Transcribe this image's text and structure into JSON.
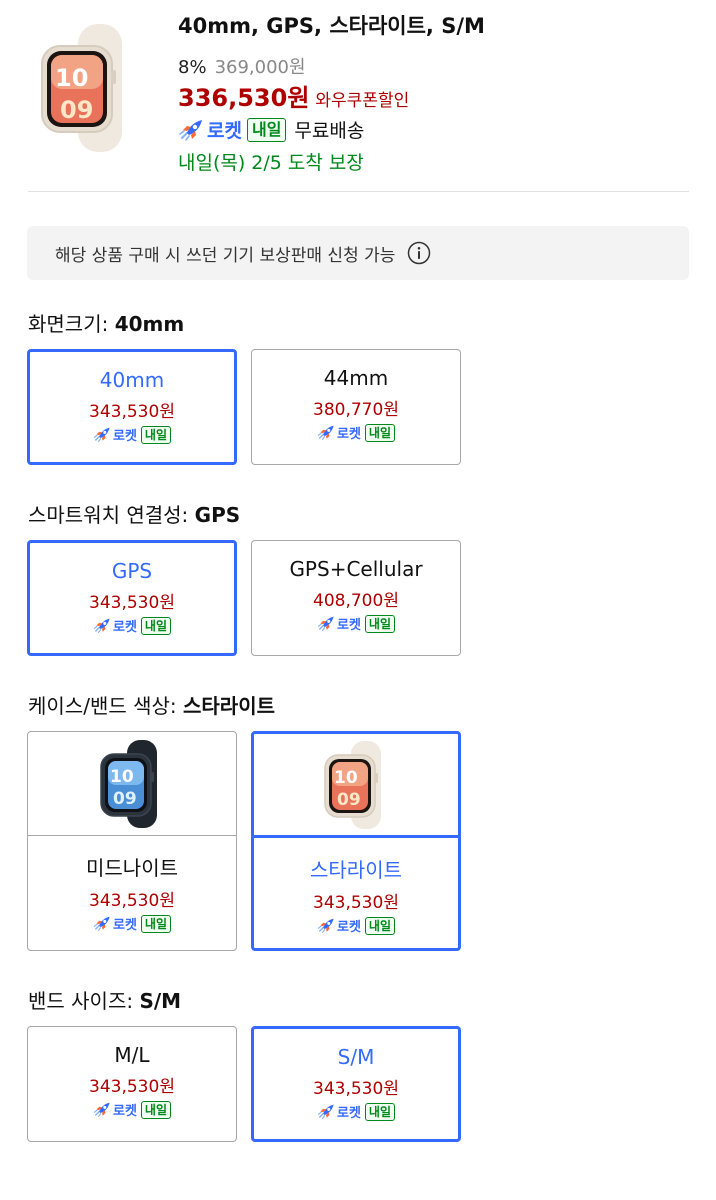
{
  "product": {
    "title": "40mm, GPS, 스타라이트, S/M",
    "discount": "8%",
    "original_price": "369,000원",
    "sale_price": "336,530원",
    "coupon_label": "와우쿠폰할인",
    "rocket_label": "로켓",
    "rocket_badge": "내일",
    "shipping": "무료배송",
    "delivery": "내일(목) 2/5 도착 보장"
  },
  "tradein": {
    "text": "해당 상품 구매 시 쓰던 기기 보상판매 신청 가능"
  },
  "sections": [
    {
      "label": "화면크기: ",
      "value": "40mm",
      "options": [
        {
          "name": "40mm",
          "price": "343,530원",
          "selected": true
        },
        {
          "name": "44mm",
          "price": "380,770원",
          "selected": false
        }
      ]
    },
    {
      "label": "스마트워치 연결성: ",
      "value": "GPS",
      "options": [
        {
          "name": "GPS",
          "price": "343,530원",
          "selected": true
        },
        {
          "name": "GPS+Cellular",
          "price": "408,700원",
          "selected": false
        }
      ]
    },
    {
      "label": "케이스/밴드 색상: ",
      "value": "스타라이트",
      "options": [
        {
          "name": "미드나이트",
          "price": "343,530원",
          "selected": false,
          "image": "midnight-watch"
        },
        {
          "name": "스타라이트",
          "price": "343,530원",
          "selected": true,
          "image": "starlight-watch"
        }
      ]
    },
    {
      "label": "밴드 사이즈: ",
      "value": "S/M",
      "options": [
        {
          "name": "M/L",
          "price": "343,530원",
          "selected": false
        },
        {
          "name": "S/M",
          "price": "343,530원",
          "selected": true
        }
      ]
    }
  ],
  "option_rocket": {
    "label": "로켓",
    "badge": "내일"
  },
  "colors": {
    "accent_blue": "#346aff",
    "price_red": "#ae0000",
    "delivery_green": "#00891a",
    "starlight": "#ece4d8",
    "midnight": "#232a33"
  },
  "icons": [
    "rocket-icon",
    "info-icon",
    "starlight-watch-image",
    "midnight-watch-image"
  ]
}
